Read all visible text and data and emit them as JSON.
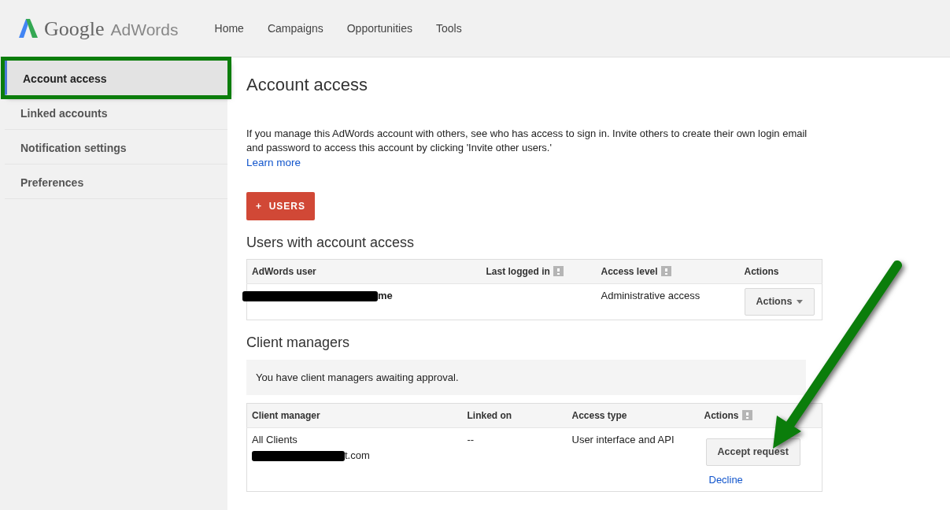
{
  "header": {
    "logo": {
      "brand": "Google",
      "product": "AdWords"
    },
    "nav": [
      "Home",
      "Campaigns",
      "Opportunities",
      "Tools"
    ]
  },
  "sidebar": {
    "items": [
      {
        "label": "Account access",
        "selected": true,
        "highlighted": true
      },
      {
        "label": "Linked accounts",
        "selected": false,
        "highlighted": false
      },
      {
        "label": "Notification settings",
        "selected": false,
        "highlighted": false
      },
      {
        "label": "Preferences",
        "selected": false,
        "highlighted": false
      }
    ]
  },
  "main": {
    "title": "Account access",
    "intro": "If you manage this AdWords account with others, see who has access to sign in. Invite others to create their own login email and password to access this account by clicking 'Invite other users.'",
    "learn_more": "Learn more",
    "add_button": {
      "icon": "+",
      "label": "USERS"
    },
    "users": {
      "heading": "Users with account access",
      "columns": [
        {
          "label": "AdWords user",
          "help": false
        },
        {
          "label": "Last logged in",
          "help": true
        },
        {
          "label": "Access level",
          "help": true
        },
        {
          "label": "Actions",
          "help": false
        }
      ],
      "rows": [
        {
          "user": {
            "redacted": true,
            "visible": "me"
          },
          "last_logged_in": "",
          "access_level": "Administrative access",
          "action": "Actions"
        }
      ]
    },
    "client_managers": {
      "heading": "Client managers",
      "notice": "You have client managers awaiting approval.",
      "columns": [
        {
          "label": "Client manager",
          "help": false
        },
        {
          "label": "Linked on",
          "help": false
        },
        {
          "label": "Access type",
          "help": false
        },
        {
          "label": "Actions",
          "help": true
        }
      ],
      "rows": [
        {
          "name": "All Clients",
          "email": {
            "redacted": true,
            "visible": "t.com"
          },
          "linked_on": "--",
          "access_type": "User interface and API",
          "accept": "Accept request",
          "decline": "Decline"
        }
      ]
    }
  }
}
